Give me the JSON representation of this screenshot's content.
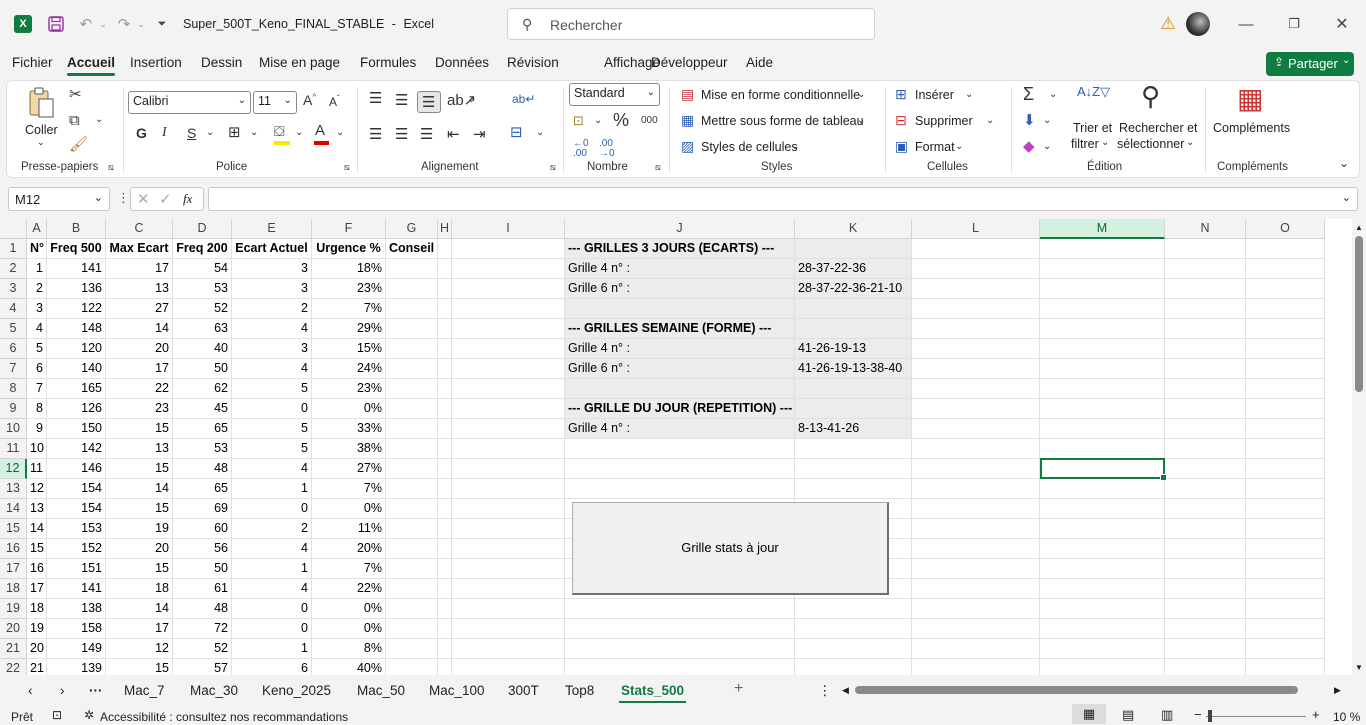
{
  "app": {
    "filename": "Super_500T_Keno_FINAL_STABLE",
    "sep": "-",
    "app_name": "Excel",
    "search_placeholder": "Rechercher"
  },
  "menu": [
    "Fichier",
    "Accueil",
    "Insertion",
    "Dessin",
    "Mise en page",
    "Formules",
    "Données",
    "Révision",
    "Affichage",
    "Développeur",
    "Aide"
  ],
  "share_label": "Partager",
  "ribbon": {
    "clipboard": {
      "label": "Presse-papiers",
      "paste": "Coller"
    },
    "font": {
      "label": "Police",
      "name": "Calibri",
      "size": "11",
      "bold": "G",
      "italic": "I",
      "underline": "S"
    },
    "alignment": {
      "label": "Alignement"
    },
    "number": {
      "label": "Nombre",
      "format": "Standard",
      "pct": "%",
      "thousands": "000",
      "inc": "←0\n.00",
      "dec": ".00\n→,0"
    },
    "styles": {
      "label": "Styles",
      "cond": "Mise en forme conditionnelle",
      "table": "Mettre sous forme de tableau",
      "cell": "Styles de cellules"
    },
    "cells": {
      "label": "Cellules",
      "insert": "Insérer",
      "delete": "Supprimer",
      "format": "Format"
    },
    "edit": {
      "label": "Édition",
      "sort1": "Trier et",
      "sort2": "filtrer",
      "find1": "Rechercher et",
      "find2": "sélectionner"
    },
    "addins": {
      "label": "Compléments",
      "btn": "Compléments"
    }
  },
  "formula_bar": {
    "namebox": "M12",
    "fx": "fx",
    "value": ""
  },
  "columns": [
    "A",
    "B",
    "C",
    "D",
    "E",
    "F",
    "G",
    "H",
    "I",
    "J",
    "K",
    "L",
    "M",
    "N",
    "O"
  ],
  "rows": [
    "1",
    "2",
    "3",
    "4",
    "5",
    "6",
    "7",
    "8",
    "9",
    "10",
    "11",
    "12",
    "13",
    "14",
    "15",
    "16",
    "17",
    "18",
    "19",
    "20",
    "21",
    "22"
  ],
  "headers": [
    "N°",
    "Freq 500",
    "Max Ecart",
    "Freq 200",
    "Ecart Actuel",
    "Urgence %",
    "Conseil"
  ],
  "table": [
    [
      "1",
      "141",
      "17",
      "54",
      "3",
      "18%"
    ],
    [
      "2",
      "136",
      "13",
      "53",
      "3",
      "23%"
    ],
    [
      "3",
      "122",
      "27",
      "52",
      "2",
      "7%"
    ],
    [
      "4",
      "148",
      "14",
      "63",
      "4",
      "29%"
    ],
    [
      "5",
      "120",
      "20",
      "40",
      "3",
      "15%"
    ],
    [
      "6",
      "140",
      "17",
      "50",
      "4",
      "24%"
    ],
    [
      "7",
      "165",
      "22",
      "62",
      "5",
      "23%"
    ],
    [
      "8",
      "126",
      "23",
      "45",
      "0",
      "0%"
    ],
    [
      "9",
      "150",
      "15",
      "65",
      "5",
      "33%"
    ],
    [
      "10",
      "142",
      "13",
      "53",
      "5",
      "38%"
    ],
    [
      "11",
      "146",
      "15",
      "48",
      "4",
      "27%"
    ],
    [
      "12",
      "154",
      "14",
      "65",
      "1",
      "7%"
    ],
    [
      "13",
      "154",
      "15",
      "69",
      "0",
      "0%"
    ],
    [
      "14",
      "153",
      "19",
      "60",
      "2",
      "11%"
    ],
    [
      "15",
      "152",
      "20",
      "56",
      "4",
      "20%"
    ],
    [
      "16",
      "151",
      "15",
      "50",
      "1",
      "7%"
    ],
    [
      "17",
      "141",
      "18",
      "61",
      "4",
      "22%"
    ],
    [
      "18",
      "138",
      "14",
      "48",
      "0",
      "0%"
    ],
    [
      "19",
      "158",
      "17",
      "72",
      "0",
      "0%"
    ],
    [
      "20",
      "149",
      "12",
      "52",
      "1",
      "8%"
    ],
    [
      "21",
      "139",
      "15",
      "57",
      "6",
      "40%"
    ]
  ],
  "grilles": [
    {
      "j": "--- GRILLES 3 JOURS (ECARTS) ---",
      "k": "",
      "bold": true
    },
    {
      "j": "Grille 4 n° :",
      "k": "28-37-22-36"
    },
    {
      "j": "Grille 6 n° :",
      "k": "28-37-22-36-21-10"
    },
    {
      "j": "",
      "k": ""
    },
    {
      "j": "--- GRILLES SEMAINE (FORME) ---",
      "k": "",
      "bold": true
    },
    {
      "j": "Grille 4 n° :",
      "k": "41-26-19-13"
    },
    {
      "j": "Grille 6 n° :",
      "k": "41-26-19-13-38-40"
    },
    {
      "j": "",
      "k": ""
    },
    {
      "j": "--- GRILLE DU JOUR (REPETITION) ---",
      "k": "",
      "bold": true
    },
    {
      "j": "Grille 4 n° :",
      "k": "8-13-41-26"
    }
  ],
  "macro_button": "Grille stats à jour",
  "sheets": [
    "Mac_7",
    "Mac_30",
    "Keno_2025",
    "Mac_50",
    "Mac_100",
    "300T",
    "Top8",
    "Stats_500"
  ],
  "active_sheet": "Stats_500",
  "status": {
    "ready": "Prêt",
    "accessibility": "Accessibilité : consultez nos recommandations",
    "zoom": "10 %"
  }
}
